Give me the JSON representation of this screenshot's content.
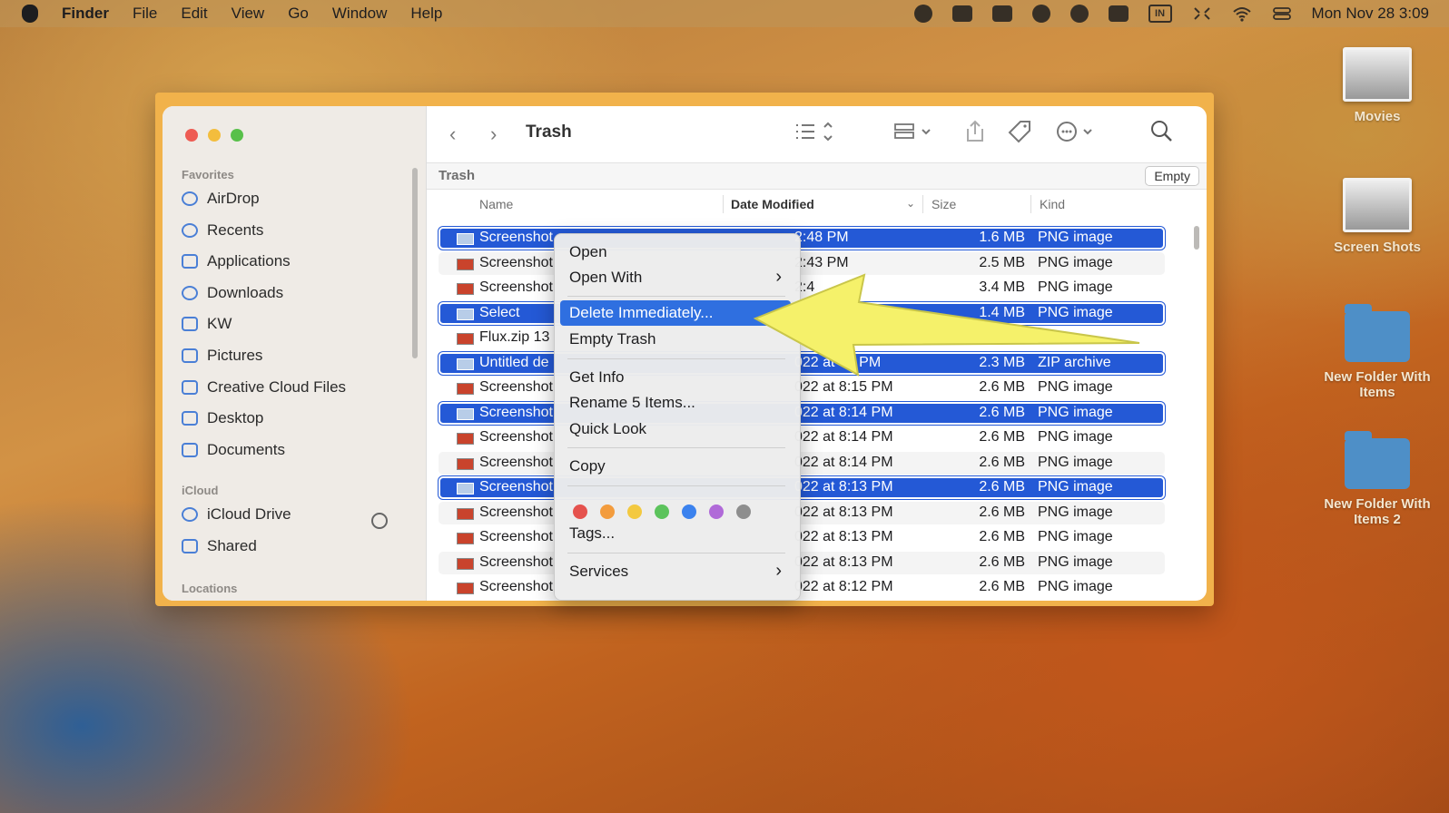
{
  "menubar": {
    "app": "Finder",
    "items": [
      "File",
      "Edit",
      "View",
      "Go",
      "Window",
      "Help"
    ],
    "status_icons": [
      "creative-cloud-icon",
      "screenshot-icon",
      "mail-icon",
      "grammarly-icon",
      "checkmark-icon",
      "a-icon",
      "input-source-icon",
      "expand-icon",
      "wifi-icon",
      "control-center-icon"
    ],
    "input_badge": "IN",
    "clock": "Mon Nov 28  3:09"
  },
  "desktop": [
    {
      "label": "Movies",
      "kind": "photo"
    },
    {
      "label": "Screen Shots",
      "kind": "photo"
    },
    {
      "label": "New Folder With Items",
      "kind": "folder"
    },
    {
      "label": "New Folder With Items 2",
      "kind": "folder"
    }
  ],
  "sidebar": {
    "favorites_label": "Favorites",
    "favorites": [
      "AirDrop",
      "Recents",
      "Applications",
      "Downloads",
      "KW",
      "Pictures",
      "Creative Cloud Files",
      "Desktop",
      "Documents"
    ],
    "icloud_label": "iCloud",
    "icloud": [
      "iCloud Drive",
      "Shared"
    ],
    "locations_label": "Locations"
  },
  "toolbar": {
    "title": "Trash"
  },
  "pathbar": {
    "label": "Trash",
    "empty_button": "Empty"
  },
  "columns": {
    "name": "Name",
    "date": "Date Modified",
    "size": "Size",
    "kind": "Kind"
  },
  "rows": [
    {
      "name": "Screenshot",
      "date": "2:48 PM",
      "size": "1.6 MB",
      "kind": "PNG image",
      "selected": true
    },
    {
      "name": "Screenshot",
      "date": "2:43 PM",
      "size": "2.5 MB",
      "kind": "PNG image",
      "selected": false
    },
    {
      "name": "Screenshot",
      "date": "2:4",
      "size": "3.4 MB",
      "kind": "PNG image",
      "selected": false
    },
    {
      "name": "Select",
      "date": "",
      "size": "1.4 MB",
      "kind": "PNG image",
      "selected": true
    },
    {
      "name": "Flux.zip 13",
      "date": "",
      "size": "",
      "kind": "...hive",
      "selected": false
    },
    {
      "name": "Untitled de",
      "date": "022 at  49 PM",
      "size": "2.3 MB",
      "kind": "ZIP archive",
      "selected": true
    },
    {
      "name": "Screenshot",
      "date": "022 at 8:15 PM",
      "size": "2.6 MB",
      "kind": "PNG image",
      "selected": false
    },
    {
      "name": "Screenshot",
      "date": "022 at 8:14 PM",
      "size": "2.6 MB",
      "kind": "PNG image",
      "selected": true
    },
    {
      "name": "Screenshot",
      "date": "022 at 8:14 PM",
      "size": "2.6 MB",
      "kind": "PNG image",
      "selected": false
    },
    {
      "name": "Screenshot",
      "date": "022 at 8:14 PM",
      "size": "2.6 MB",
      "kind": "PNG image",
      "selected": false
    },
    {
      "name": "Screenshot",
      "date": "022 at 8:13 PM",
      "size": "2.6 MB",
      "kind": "PNG image",
      "selected": true
    },
    {
      "name": "Screenshot",
      "date": "022 at 8:13 PM",
      "size": "2.6 MB",
      "kind": "PNG image",
      "selected": false
    },
    {
      "name": "Screenshot",
      "date": "022 at 8:13 PM",
      "size": "2.6 MB",
      "kind": "PNG image",
      "selected": false
    },
    {
      "name": "Screenshot",
      "date": "022 at 8:13 PM",
      "size": "2.6 MB",
      "kind": "PNG image",
      "selected": false
    },
    {
      "name": "Screenshot",
      "date": "022 at 8:12 PM",
      "size": "2.6 MB",
      "kind": "PNG image",
      "selected": false
    }
  ],
  "context_menu": {
    "open": "Open",
    "open_with": "Open With",
    "delete_immediately": "Delete Immediately...",
    "empty_trash": "Empty Trash",
    "get_info": "Get Info",
    "rename": "Rename 5 Items...",
    "quick_look": "Quick Look",
    "copy": "Copy",
    "tags": "Tags...",
    "services": "Services",
    "tag_colors": [
      "#e5524d",
      "#f39c3d",
      "#f3c940",
      "#5cc35c",
      "#3b82ee",
      "#b06ad8",
      "#8e8e8e"
    ]
  },
  "colors": {
    "selection": "#2459d6",
    "menu_highlight": "#2f6fe0",
    "arrow": "#f5f16a"
  }
}
